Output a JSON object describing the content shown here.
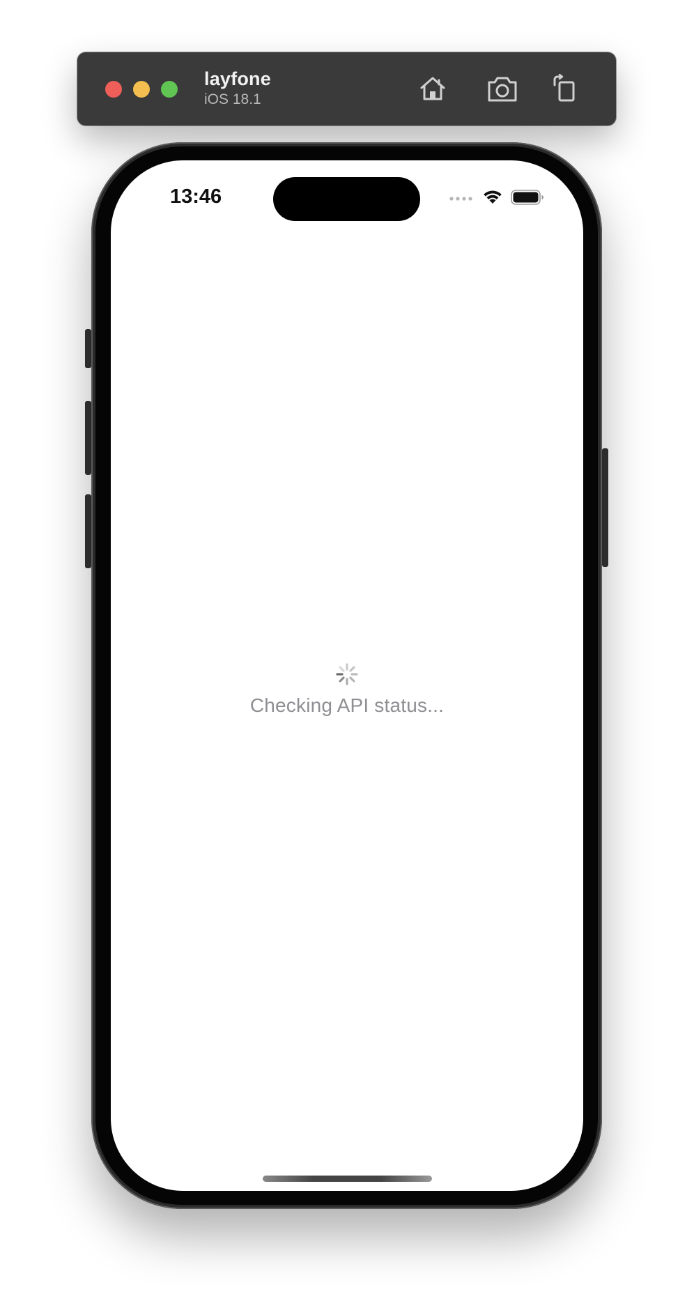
{
  "simulator": {
    "device_name": "layfone",
    "os_version": "iOS 18.1",
    "toolbar": {
      "home_icon": "home-icon",
      "screenshot_icon": "camera-icon",
      "rotate_icon": "rotate-icon"
    }
  },
  "status_bar": {
    "time": "13:46"
  },
  "main": {
    "loading_text": "Checking API status..."
  },
  "colors": {
    "close": "#ee5f5a",
    "minimize": "#f4bf4f",
    "zoom": "#61c554",
    "loading_text": "#8e8e93"
  }
}
